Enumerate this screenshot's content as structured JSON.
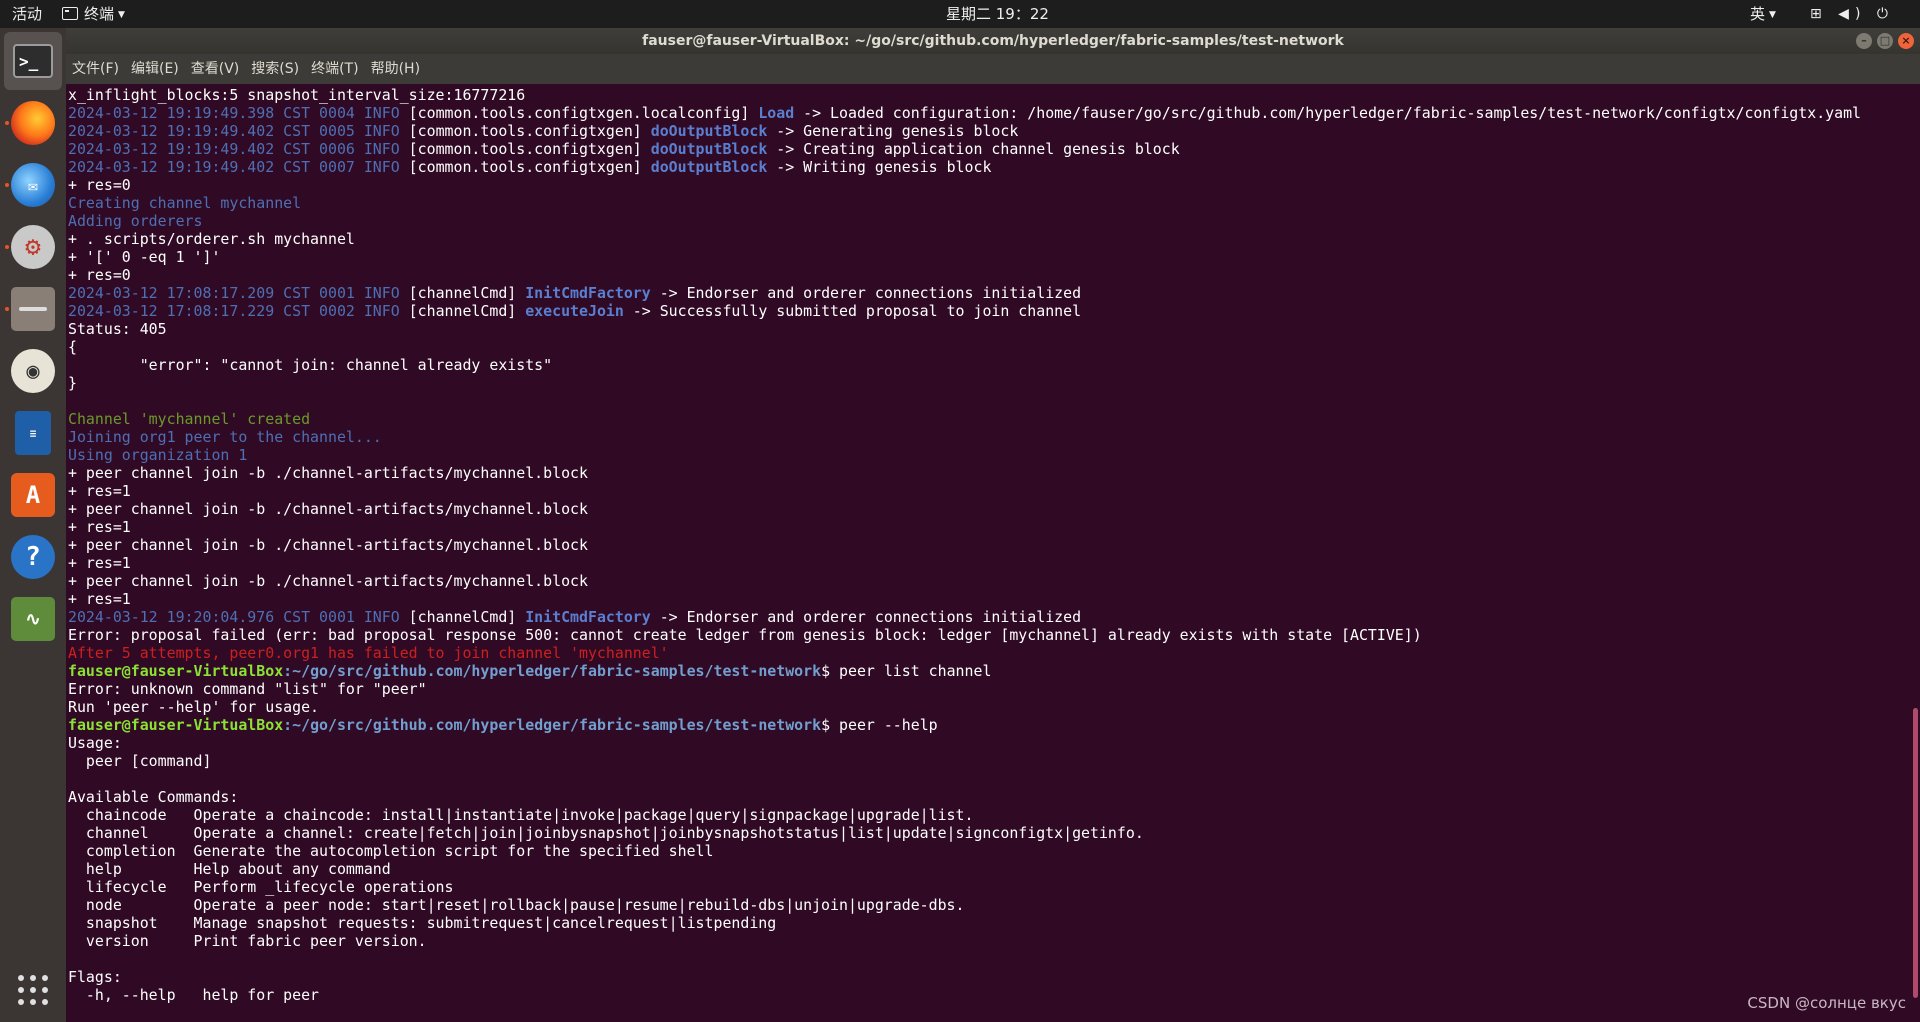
{
  "topbar": {
    "activities": "活动",
    "app_name": "终端",
    "clock": "星期二 19：22",
    "input_method": "英",
    "tray_icons": [
      "network-icon",
      "volume-icon",
      "power-icon"
    ],
    "tray_glyphs": "⊞ ◀) ⏻"
  },
  "dock": {
    "apps": [
      "terminal",
      "firefox",
      "thunderbird",
      "settings-tool",
      "files",
      "rhythmbox",
      "libreoffice-writer",
      "software-center",
      "help",
      "system-monitor",
      "show-applications"
    ]
  },
  "window": {
    "title": "fauser@fauser-VirtualBox: ~/go/src/github.com/hyperledger/fabric-samples/test-network",
    "menu": [
      "文件(F)",
      "编辑(E)",
      "查看(V)",
      "搜索(S)",
      "终端(T)",
      "帮助(H)"
    ]
  },
  "terminal": {
    "prompt_user": "fauser@fauser-VirtualBox",
    "prompt_path": ":~/go/src/github.com/hyperledger/fabric-samples/test-network",
    "lines": [
      {
        "parts": [
          {
            "t": "x_inflight_blocks:5 snapshot_interval_size:16777216",
            "c": ""
          }
        ]
      },
      {
        "parts": [
          {
            "t": "2024-03-12 19:19:49.398 CST 0004 INFO",
            "c": "info"
          },
          {
            "t": " [common.tools.configtxgen.localconfig] ",
            "c": ""
          },
          {
            "t": "Load",
            "c": "fn"
          },
          {
            "t": " -> Loaded configuration: /home/fauser/go/src/github.com/hyperledger/fabric-samples/test-network/configtx/configtx.yaml",
            "c": ""
          }
        ]
      },
      {
        "parts": [
          {
            "t": "2024-03-12 19:19:49.402 CST 0005 INFO",
            "c": "info"
          },
          {
            "t": " [common.tools.configtxgen] ",
            "c": ""
          },
          {
            "t": "doOutputBlock",
            "c": "fn"
          },
          {
            "t": " -> Generating genesis block",
            "c": ""
          }
        ]
      },
      {
        "parts": [
          {
            "t": "2024-03-12 19:19:49.402 CST 0006 INFO",
            "c": "info"
          },
          {
            "t": " [common.tools.configtxgen] ",
            "c": ""
          },
          {
            "t": "doOutputBlock",
            "c": "fn"
          },
          {
            "t": " -> Creating application channel genesis block",
            "c": ""
          }
        ]
      },
      {
        "parts": [
          {
            "t": "2024-03-12 19:19:49.402 CST 0007 INFO",
            "c": "info"
          },
          {
            "t": " [common.tools.configtxgen] ",
            "c": ""
          },
          {
            "t": "doOutputBlock",
            "c": "fn"
          },
          {
            "t": " -> Writing genesis block",
            "c": ""
          }
        ]
      },
      {
        "parts": [
          {
            "t": "+ res=0",
            "c": ""
          }
        ]
      },
      {
        "parts": [
          {
            "t": "Creating channel mychannel",
            "c": "dim"
          }
        ]
      },
      {
        "parts": [
          {
            "t": "Adding orderers",
            "c": "dim"
          }
        ]
      },
      {
        "parts": [
          {
            "t": "+ . scripts/orderer.sh mychannel",
            "c": ""
          }
        ]
      },
      {
        "parts": [
          {
            "t": "+ '[' 0 -eq 1 ']'",
            "c": ""
          }
        ]
      },
      {
        "parts": [
          {
            "t": "+ res=0",
            "c": ""
          }
        ]
      },
      {
        "parts": [
          {
            "t": "2024-03-12 17:08:17.209 CST 0001 INFO",
            "c": "info"
          },
          {
            "t": " [channelCmd] ",
            "c": ""
          },
          {
            "t": "InitCmdFactory",
            "c": "fn"
          },
          {
            "t": " -> Endorser and orderer connections initialized",
            "c": ""
          }
        ]
      },
      {
        "parts": [
          {
            "t": "2024-03-12 17:08:17.229 CST 0002 INFO",
            "c": "info"
          },
          {
            "t": " [channelCmd] ",
            "c": ""
          },
          {
            "t": "executeJoin",
            "c": "fn"
          },
          {
            "t": " -> Successfully submitted proposal to join channel",
            "c": ""
          }
        ]
      },
      {
        "parts": [
          {
            "t": "Status: 405",
            "c": ""
          }
        ]
      },
      {
        "parts": [
          {
            "t": "{",
            "c": ""
          }
        ]
      },
      {
        "parts": [
          {
            "t": "        \"error\": \"cannot join: channel already exists\"",
            "c": ""
          }
        ]
      },
      {
        "parts": [
          {
            "t": "}",
            "c": ""
          }
        ]
      },
      {
        "parts": [
          {
            "t": "",
            "c": ""
          }
        ]
      },
      {
        "parts": [
          {
            "t": "Channel 'mychannel' created",
            "c": "green"
          }
        ]
      },
      {
        "parts": [
          {
            "t": "Joining org1 peer to the channel...",
            "c": "dim"
          }
        ]
      },
      {
        "parts": [
          {
            "t": "Using organization 1",
            "c": "dim"
          }
        ]
      },
      {
        "parts": [
          {
            "t": "+ peer channel join -b ./channel-artifacts/mychannel.block",
            "c": ""
          }
        ]
      },
      {
        "parts": [
          {
            "t": "+ res=1",
            "c": ""
          }
        ]
      },
      {
        "parts": [
          {
            "t": "+ peer channel join -b ./channel-artifacts/mychannel.block",
            "c": ""
          }
        ]
      },
      {
        "parts": [
          {
            "t": "+ res=1",
            "c": ""
          }
        ]
      },
      {
        "parts": [
          {
            "t": "+ peer channel join -b ./channel-artifacts/mychannel.block",
            "c": ""
          }
        ]
      },
      {
        "parts": [
          {
            "t": "+ res=1",
            "c": ""
          }
        ]
      },
      {
        "parts": [
          {
            "t": "+ peer channel join -b ./channel-artifacts/mychannel.block",
            "c": ""
          }
        ]
      },
      {
        "parts": [
          {
            "t": "+ res=1",
            "c": ""
          }
        ]
      },
      {
        "parts": [
          {
            "t": "2024-03-12 19:20:04.976 CST 0001 INFO",
            "c": "info"
          },
          {
            "t": " [channelCmd] ",
            "c": ""
          },
          {
            "t": "InitCmdFactory",
            "c": "fn"
          },
          {
            "t": " -> Endorser and orderer connections initialized",
            "c": ""
          }
        ]
      },
      {
        "parts": [
          {
            "t": "Error: proposal failed (err: bad proposal response 500: cannot create ledger from genesis block: ledger [mychannel] already exists with state [ACTIVE])",
            "c": ""
          }
        ]
      },
      {
        "parts": [
          {
            "t": "After 5 attempts, peer0.org1 has failed to join channel 'mychannel'",
            "c": "red"
          }
        ]
      },
      {
        "prompt": true,
        "parts": [
          {
            "t": "$ peer list channel",
            "c": ""
          }
        ]
      },
      {
        "parts": [
          {
            "t": "Error: unknown command \"list\" for \"peer\"",
            "c": ""
          }
        ]
      },
      {
        "parts": [
          {
            "t": "Run 'peer --help' for usage.",
            "c": ""
          }
        ]
      },
      {
        "prompt": true,
        "parts": [
          {
            "t": "$ peer --help",
            "c": ""
          }
        ]
      },
      {
        "parts": [
          {
            "t": "Usage:",
            "c": ""
          }
        ]
      },
      {
        "parts": [
          {
            "t": "  peer [command]",
            "c": ""
          }
        ]
      },
      {
        "parts": [
          {
            "t": "",
            "c": ""
          }
        ]
      },
      {
        "parts": [
          {
            "t": "Available Commands:",
            "c": ""
          }
        ]
      },
      {
        "parts": [
          {
            "t": "  chaincode   Operate a chaincode: install|instantiate|invoke|package|query|signpackage|upgrade|list.",
            "c": ""
          }
        ]
      },
      {
        "parts": [
          {
            "t": "  channel     Operate a channel: create|fetch|join|joinbysnapshot|joinbysnapshotstatus|list|update|signconfigtx|getinfo.",
            "c": ""
          }
        ]
      },
      {
        "parts": [
          {
            "t": "  completion  Generate the autocompletion script for the specified shell",
            "c": ""
          }
        ]
      },
      {
        "parts": [
          {
            "t": "  help        Help about any command",
            "c": ""
          }
        ]
      },
      {
        "parts": [
          {
            "t": "  lifecycle   Perform _lifecycle operations",
            "c": ""
          }
        ]
      },
      {
        "parts": [
          {
            "t": "  node        Operate a peer node: start|reset|rollback|pause|resume|rebuild-dbs|unjoin|upgrade-dbs.",
            "c": ""
          }
        ]
      },
      {
        "parts": [
          {
            "t": "  snapshot    Manage snapshot requests: submitrequest|cancelrequest|listpending",
            "c": ""
          }
        ]
      },
      {
        "parts": [
          {
            "t": "  version     Print fabric peer version.",
            "c": ""
          }
        ]
      },
      {
        "parts": [
          {
            "t": "",
            "c": ""
          }
        ]
      },
      {
        "parts": [
          {
            "t": "Flags:",
            "c": ""
          }
        ]
      },
      {
        "parts": [
          {
            "t": "  -h, --help   help for peer",
            "c": ""
          }
        ]
      }
    ]
  },
  "watermark": "CSDN @солнце вкус"
}
